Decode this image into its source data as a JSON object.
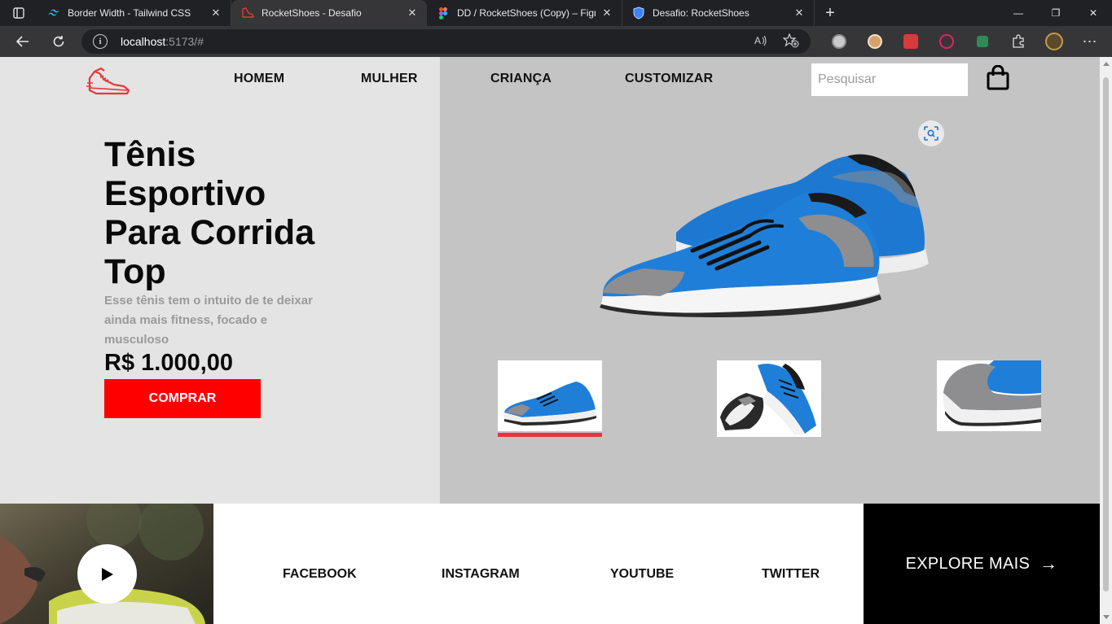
{
  "browser": {
    "tabs": [
      {
        "title": "Border Width - Tailwind CSS",
        "icon": "tailwind-icon",
        "active": false
      },
      {
        "title": "RocketShoes - Desafio",
        "icon": "rocketshoes-icon",
        "active": true
      },
      {
        "title": "DD / RocketShoes (Copy) – Figma",
        "icon": "figma-icon",
        "active": false
      },
      {
        "title": "Desafio: RocketShoes",
        "icon": "shield-icon",
        "active": false
      }
    ],
    "close_glyph": "✕",
    "new_tab_glyph": "+",
    "window": {
      "minimize": "—",
      "maximize": "❐",
      "close": "✕"
    },
    "url_host": "localhost",
    "url_rest": ":5173/#",
    "info_glyph": "i"
  },
  "header": {
    "nav": [
      "HOMEM",
      "MULHER",
      "CRIANÇA",
      "CUSTOMIZAR"
    ],
    "search_placeholder": "Pesquisar"
  },
  "hero": {
    "title": "Tênis Esportivo Para Corrida Top",
    "description": "Esse tênis tem o intuito de te deixar ainda mais fitness, focado e musculoso",
    "price": "R$ 1.000,00",
    "buy_label": "COMPRAR"
  },
  "footer": {
    "social": [
      "FACEBOOK",
      "INSTAGRAM",
      "YOUTUBE",
      "TWITTER"
    ],
    "explore_label": "EXPLORE MAIS",
    "explore_arrow": "→"
  },
  "colors": {
    "accent": "#ff0000",
    "hero_left_bg": "#e4e4e4",
    "hero_right_bg": "#c4c4c4",
    "shoe_blue": "#1f7fd8",
    "thumb_underline": "#e53935"
  }
}
